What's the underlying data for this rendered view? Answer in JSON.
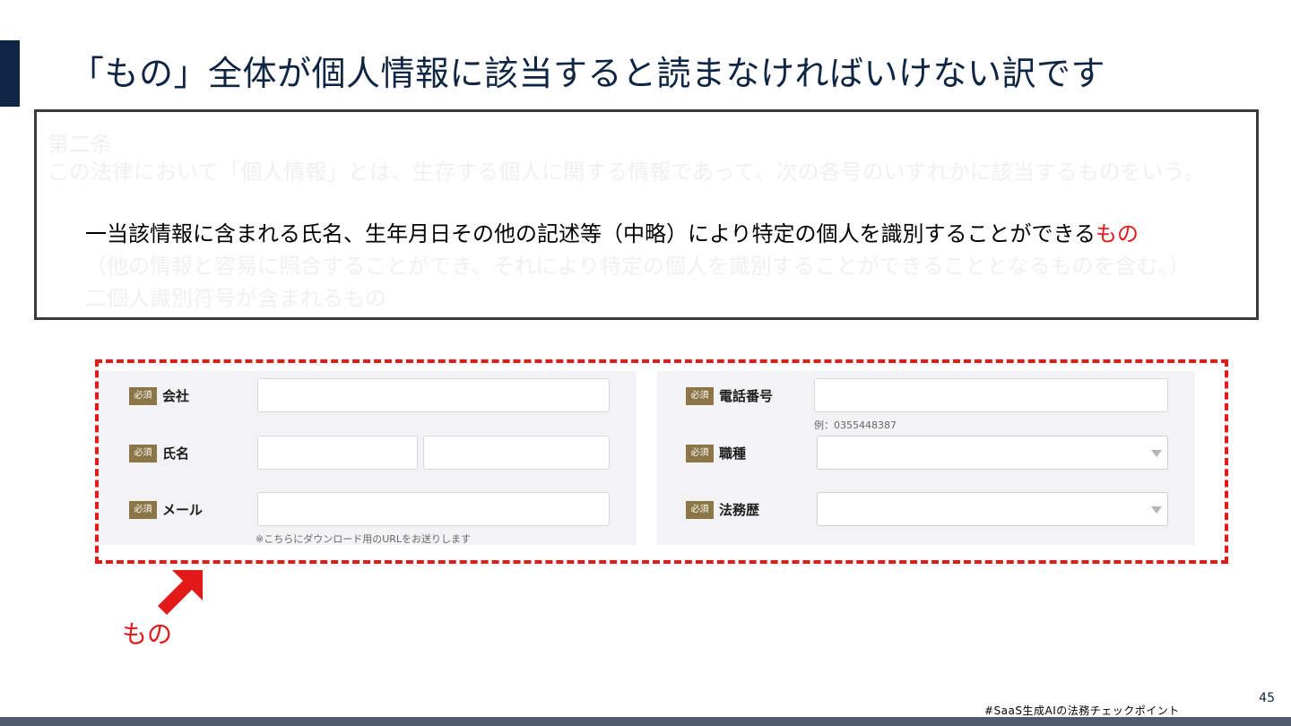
{
  "slide": {
    "title": "「もの」全体が個人情報に該当すると読まなければいけない訳です",
    "page_number": "45",
    "footer_tag": "#SaaS生成AIの法務チェックポイント"
  },
  "law": {
    "article_heading": "第二条",
    "article_text": "この法律において「個人情報」とは、生存する個人に関する情報であって、次の各号のいずれかに該当するものをいう。",
    "item1_main": "一当該情報に含まれる氏名、生年月日その他の記述等（中略）により特定の個人を識別することができる",
    "item1_highlight": "もの",
    "item1_cont": "（他の情報と容易に照合することができ、それにより特定の個人を識別することができることとなるものを含む。）",
    "item2": "二個人識別符号が含まれるもの"
  },
  "form": {
    "required_badge": "必須",
    "left": {
      "company_label": "会社",
      "name_label": "氏名",
      "email_label": "メール",
      "email_hint": "※こちらにダウンロード用のURLをお送りします"
    },
    "right": {
      "phone_label": "電話番号",
      "phone_hint": "例：0355448387",
      "job_label": "職種",
      "legal_exp_label": "法務歴"
    }
  },
  "annotation": {
    "label": "もの",
    "icon": "arrow-up-right-icon",
    "color": "#e21a1a"
  },
  "colors": {
    "title": "#0f2544",
    "badge": "#8b7647",
    "highlight": "#e21a1a"
  }
}
